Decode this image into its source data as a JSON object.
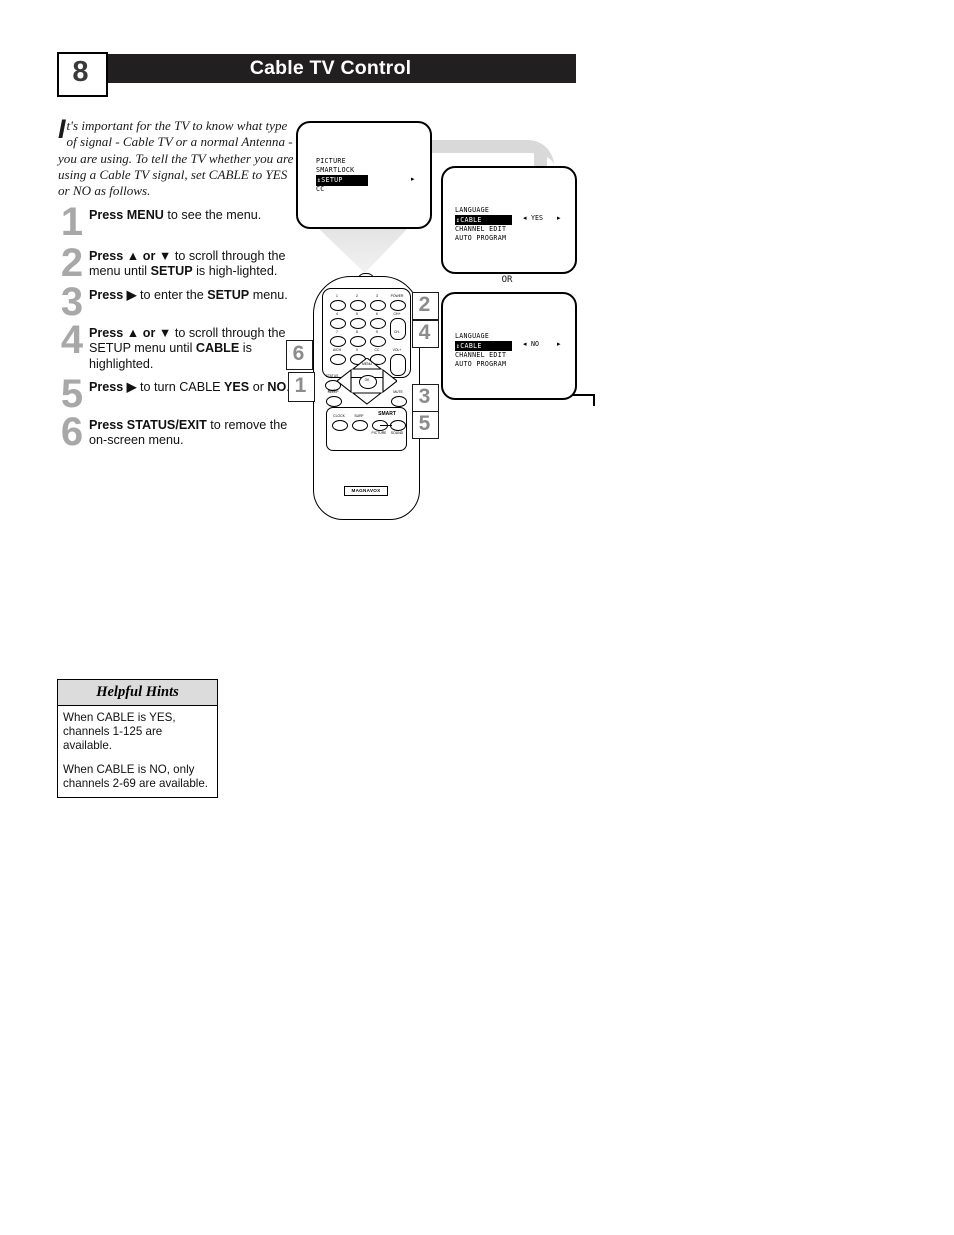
{
  "header": {
    "page_number": "8",
    "title": "Cable TV Control"
  },
  "intro": {
    "dropcap": "I",
    "text": "t's important for the TV to know what type of signal - Cable TV or a normal Antenna - you are using.  To tell the TV whether you are using a Cable TV signal, set CABLE to YES or NO as follows."
  },
  "steps": [
    {
      "num": "1",
      "html": "<b>Press MENU</b> to see the menu."
    },
    {
      "num": "2",
      "html": "<b>Press ▲ or ▼</b> to scroll through the menu until <b>SETUP</b> is high-lighted."
    },
    {
      "num": "3",
      "html": "<b>Press ▶</b> to enter the <b>SETUP</b> menu."
    },
    {
      "num": "4",
      "html": "<b>Press ▲ or ▼</b> to scroll through the SETUP menu until <b>CABLE</b> is highlighted."
    },
    {
      "num": "5",
      "html": "<b>Press ▶</b> to turn CABLE <b>YES</b> or <b>NO</b>."
    },
    {
      "num": "6",
      "html": "<b>Press STATUS/EXIT</b> to remove the on-screen menu."
    }
  ],
  "tv_screens": {
    "screen1": {
      "items": [
        "PICTURE",
        "SMARTLOCK",
        "SETUP",
        "CC"
      ],
      "selected": "SETUP",
      "selected_marker": "↕",
      "right_arrow": "▸"
    },
    "screen2": {
      "items": [
        "LANGUAGE",
        "CABLE",
        "CHANNEL EDIT",
        "AUTO PROGRAM"
      ],
      "selected": "CABLE",
      "selected_marker": "↕",
      "value": "YES",
      "left_arrow": "◂",
      "right_arrow": "▸"
    },
    "screen3": {
      "items": [
        "LANGUAGE",
        "CABLE",
        "CHANNEL EDIT",
        "AUTO PROGRAM"
      ],
      "selected": "CABLE",
      "selected_marker": "↕",
      "value": "NO",
      "left_arrow": "◂",
      "right_arrow": "▸"
    },
    "or_label": "OR"
  },
  "remote": {
    "brand": "MAGNAVOX",
    "keypad": [
      "1",
      "2",
      "3",
      "POWER",
      "4",
      "5",
      "6",
      "CH+",
      "7",
      "8",
      "9",
      "CH-",
      "A/CH",
      "0",
      "CC",
      "VOL+"
    ],
    "status_exit": "STATUS EXIT",
    "status_label_top": "STATUS",
    "status_label_bottom": "EXIT",
    "ok_label": "OK",
    "menu_label": "MENU",
    "sleep_label": "SLEEP",
    "mute_label": "MUTE",
    "bottom_keys": [
      "CLOCK",
      "SURF",
      "SMART",
      "PICTURE",
      "SOUND"
    ],
    "smart_group_label": "SMART"
  },
  "callouts": [
    {
      "num": "6",
      "target": "status-exit-button"
    },
    {
      "num": "1",
      "target": "menu-button"
    },
    {
      "num": "2",
      "target": "up-arrow-button"
    },
    {
      "num": "4",
      "target": "up-arrow-button"
    },
    {
      "num": "3",
      "target": "right-arrow-button"
    },
    {
      "num": "5",
      "target": "right-arrow-button"
    }
  ],
  "hints": {
    "title": "Helpful Hints",
    "paragraphs": [
      "When CABLE is YES, channels 1-125 are available.",
      "When CABLE is NO, only channels 2-69 are available."
    ]
  }
}
